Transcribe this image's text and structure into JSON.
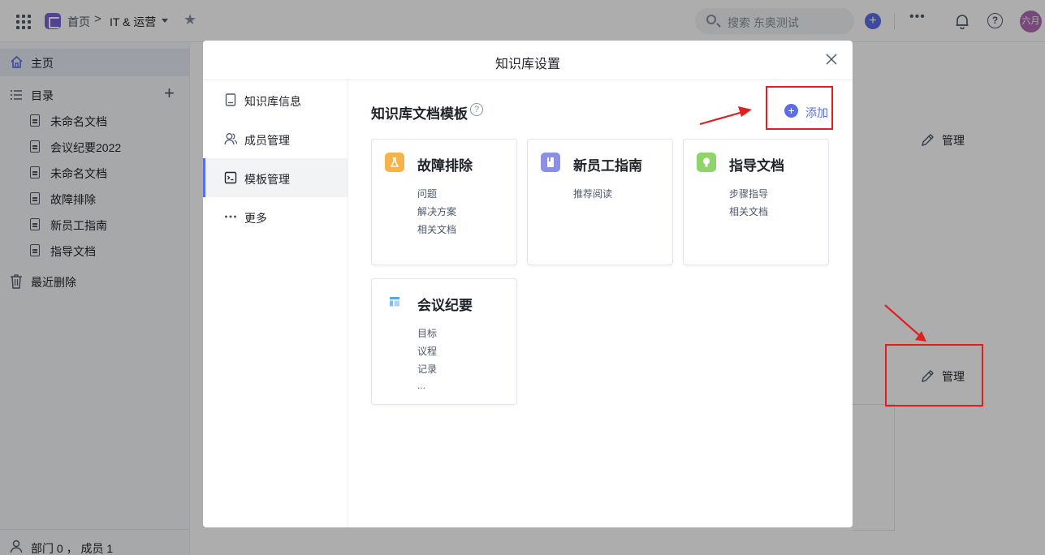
{
  "topbar": {
    "home": "首页",
    "separator": ">",
    "space": "IT & 运营",
    "search_placeholder": "搜索 东奥测试",
    "more": "•••",
    "help": "?",
    "avatar": "六月"
  },
  "sidebar": {
    "home": "主页",
    "catalog": "目录",
    "add": "+",
    "docs": [
      "未命名文档",
      "会议纪要2022",
      "未命名文档",
      "故障排除",
      "新员工指南",
      "指导文档"
    ],
    "trash": "最近删除",
    "footer": "部门 0 ， 成员 1"
  },
  "background": {
    "manage_top": "管理",
    "manage_bottom": "管理"
  },
  "modal": {
    "title": "知识库设置",
    "nav": [
      "知识库信息",
      "成员管理",
      "模板管理",
      "更多"
    ],
    "active_nav": "模板管理",
    "content_title": "知识库文档模板",
    "help": "?",
    "add_label": "添加",
    "templates": [
      {
        "title": "故障排除",
        "lines": [
          "问题",
          "解决方案",
          "相关文档"
        ],
        "color": "#f7b34a"
      },
      {
        "title": "新员工指南",
        "lines": [
          "推荐阅读"
        ],
        "color": "#8c8fe6"
      },
      {
        "title": "指导文档",
        "lines": [
          "步骤指导",
          "相关文档"
        ],
        "color": "#8fd46a"
      },
      {
        "title": "会议纪要",
        "lines": [
          "目标",
          "议程",
          "记录",
          "..."
        ],
        "color": "#5aa7e6"
      }
    ]
  },
  "colors": {
    "accent": "#5b6ee8",
    "annotation": "#e02020"
  }
}
